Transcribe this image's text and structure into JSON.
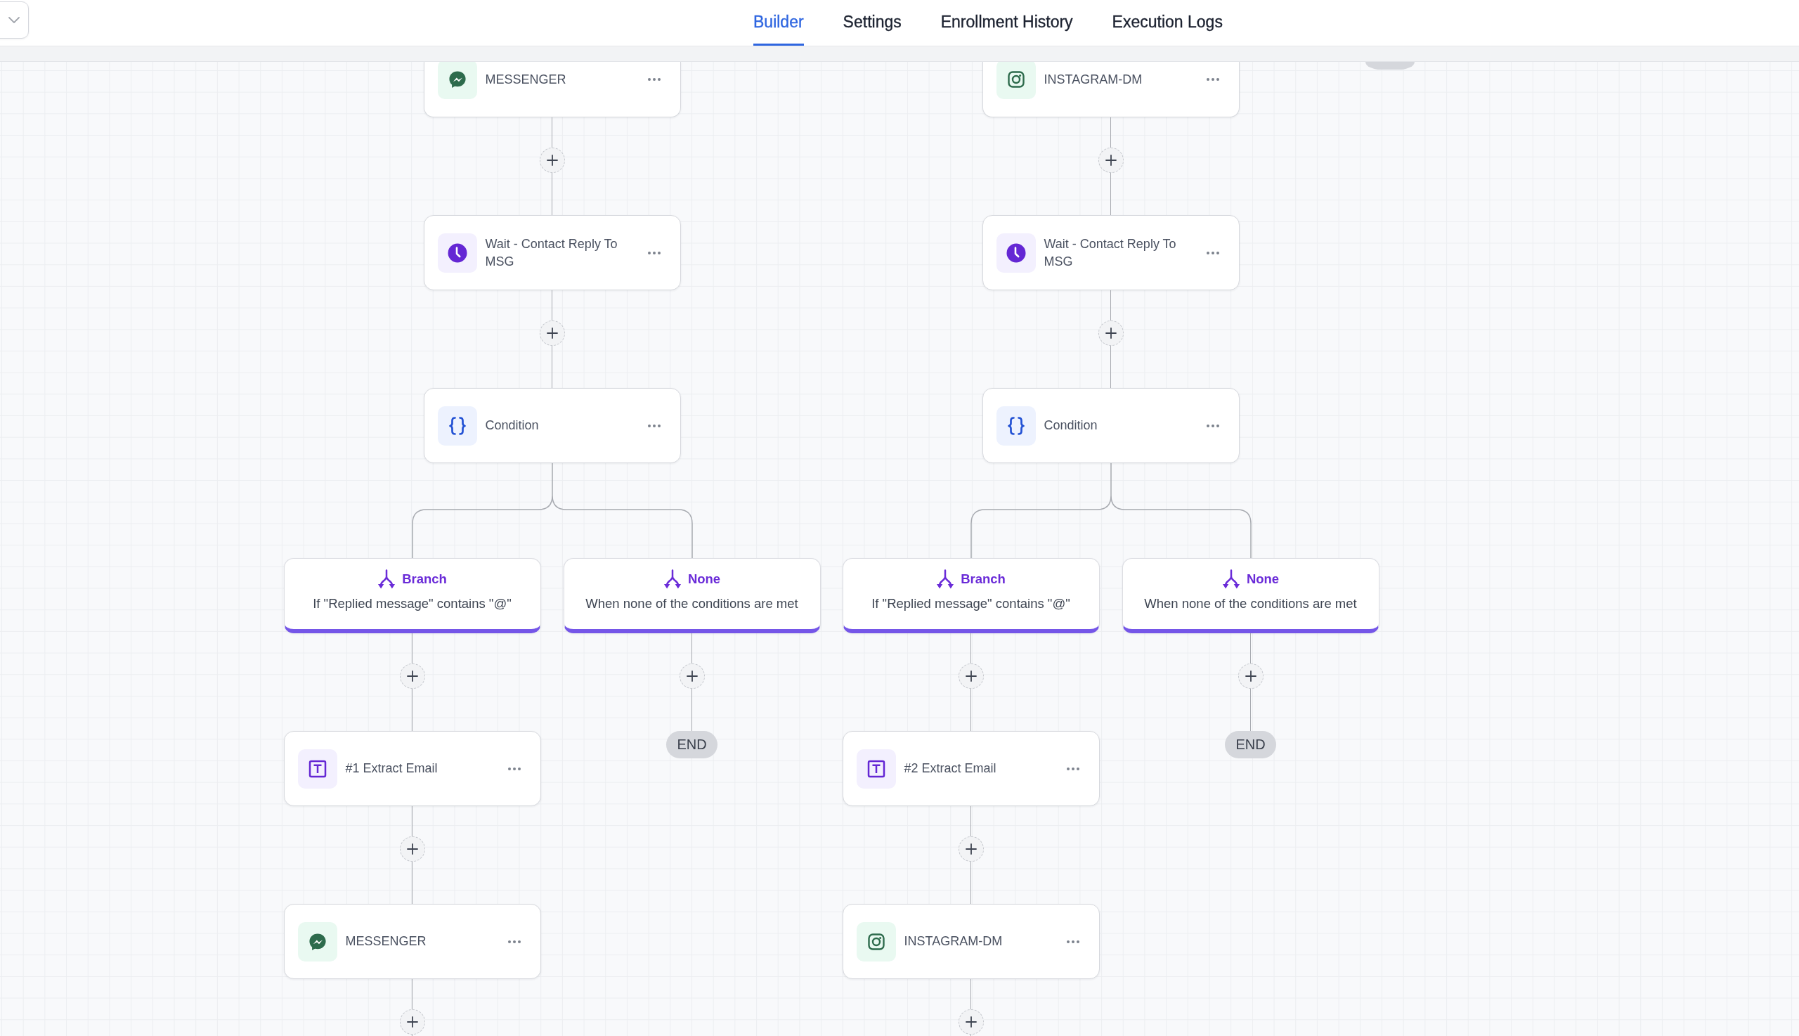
{
  "header": {
    "tabs": [
      {
        "label": "Builder",
        "selected": true
      },
      {
        "label": "Settings",
        "selected": false
      },
      {
        "label": "Enrollment History",
        "selected": false
      },
      {
        "label": "Execution Logs",
        "selected": false
      }
    ]
  },
  "canvas": {
    "flows": [
      {
        "steps": [
          {
            "kind": "messenger",
            "title": "MESSENGER"
          },
          {
            "kind": "wait",
            "title": "Wait - Contact Reply To MSG"
          },
          {
            "kind": "condition",
            "title": "Condition",
            "branches": [
              {
                "title": "Branch",
                "description": "If \"Replied message\" contains \"@\"",
                "steps": [
                  {
                    "kind": "extract",
                    "title": "#1 Extract Email"
                  },
                  {
                    "kind": "messenger",
                    "title": "MESSENGER"
                  }
                ]
              },
              {
                "title": "None",
                "description": "When none of the conditions are met",
                "steps": [
                  {
                    "kind": "end",
                    "title": "END"
                  }
                ]
              }
            ]
          }
        ]
      },
      {
        "steps": [
          {
            "kind": "instagram",
            "title": "INSTAGRAM-DM"
          },
          {
            "kind": "wait",
            "title": "Wait - Contact Reply To MSG"
          },
          {
            "kind": "condition",
            "title": "Condition",
            "branches": [
              {
                "title": "Branch",
                "description": "If \"Replied message\" contains \"@\"",
                "steps": [
                  {
                    "kind": "extract",
                    "title": "#2 Extract Email"
                  },
                  {
                    "kind": "instagram",
                    "title": "INSTAGRAM-DM"
                  }
                ]
              },
              {
                "title": "None",
                "description": "When none of the conditions are met",
                "steps": [
                  {
                    "kind": "end",
                    "title": "END"
                  }
                ]
              }
            ]
          }
        ]
      }
    ]
  }
}
